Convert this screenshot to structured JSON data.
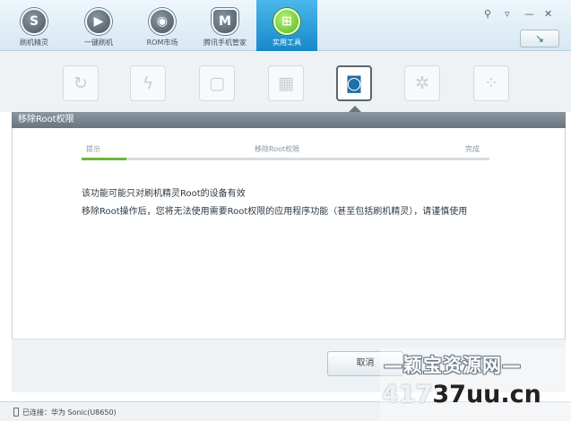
{
  "nav": {
    "tabs": [
      {
        "label": "刷机精灵",
        "icon": "s-logo-icon",
        "glyph": "S"
      },
      {
        "label": "一键刷机",
        "icon": "play-icon",
        "glyph": "▶"
      },
      {
        "label": "ROM市场",
        "icon": "rom-market-icon",
        "glyph": "◉"
      },
      {
        "label": "腾讯手机管家",
        "icon": "shield-icon",
        "glyph": "M"
      },
      {
        "label": "实用工具",
        "icon": "tools-grid-icon",
        "glyph": "⊞"
      }
    ],
    "active_index": 4
  },
  "window_controls": {
    "skin": "⚲",
    "menu": "▿",
    "minimize": "—",
    "close": "✕"
  },
  "refresh_button": "↘",
  "tools": [
    {
      "icon": "refresh-icon",
      "glyph": "↻"
    },
    {
      "icon": "lightning-icon",
      "glyph": "ϟ"
    },
    {
      "icon": "tablet-icon",
      "glyph": "▢"
    },
    {
      "icon": "gift-icon",
      "glyph": "▦"
    },
    {
      "icon": "android-root-icon",
      "glyph": "◙"
    },
    {
      "icon": "gears-icon",
      "glyph": "✲"
    },
    {
      "icon": "dots-grid-icon",
      "glyph": "⁘"
    }
  ],
  "section_title": "移除Root权限",
  "steps": [
    "提示",
    "移除Root权限",
    "完成"
  ],
  "progress_fraction": 0.11,
  "messages": {
    "line1": "该功能可能只对刷机精灵Root的设备有效",
    "line2": "移除Root操作后，您将无法使用需要Root权限的应用程序功能（甚至包括刷机精灵），请谨慎使用"
  },
  "cancel_label": "取消",
  "status": {
    "text": "已连接：华为 Sonic(U8650)"
  },
  "watermark": {
    "top": "—颖宝资源网—",
    "bottom_prefix": "417",
    "bottom_main": "37uu.cn"
  },
  "colors": {
    "accent_blue": "#1788c9",
    "progress_green": "#6fb637",
    "title_gray": "#68747e"
  }
}
